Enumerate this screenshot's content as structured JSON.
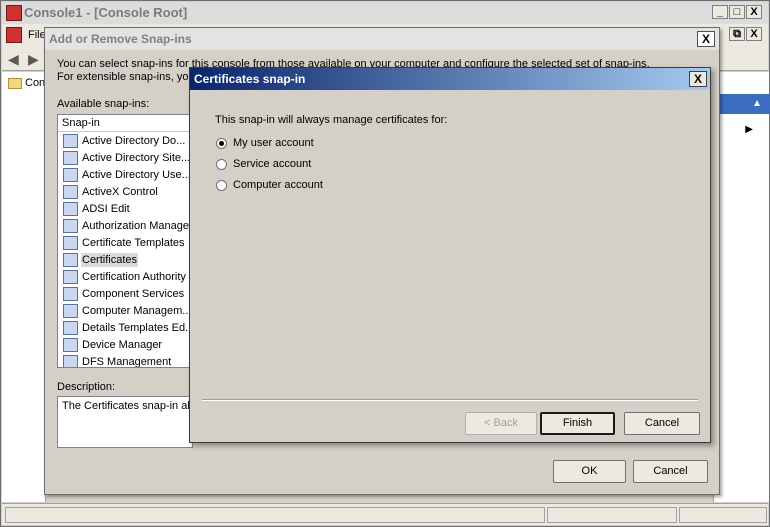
{
  "console": {
    "title": "Console1 - [Console Root]",
    "menu_file": "File",
    "tree_root": "Con",
    "window_buttons": {
      "minimize": "_",
      "maximize": "□",
      "close": "X",
      "restore": "⧉"
    }
  },
  "snapins": {
    "title": "Add or Remove Snap-ins",
    "intro": "You can select snap-ins for this console from those available on your computer and configure the selected set of snap-ins. For extensible snap-ins, you ca",
    "available_label": "Available snap-ins:",
    "list_header": "Snap-in",
    "items": [
      "Active Directory Do...",
      "Active Directory Site...",
      "Active Directory Use...",
      "ActiveX Control",
      "ADSI Edit",
      "Authorization Manager",
      "Certificate Templates",
      "Certificates",
      "Certification Authority",
      "Component Services",
      "Computer Managem...",
      "Details Templates Ed...",
      "Device Manager",
      "DFS Management"
    ],
    "selected_item": "Certificates",
    "description_label": "Description:",
    "description_text": "The Certificates snap-in all",
    "ok_label": "OK",
    "cancel_label": "Cancel",
    "close_glyph": "X"
  },
  "cert_dialog": {
    "title": "Certificates snap-in",
    "prompt": "This snap-in will always manage certificates for:",
    "options": [
      {
        "label": "My user account",
        "selected": true
      },
      {
        "label": "Service account",
        "selected": false
      },
      {
        "label": "Computer account",
        "selected": false
      }
    ],
    "back_label": "< Back",
    "finish_label": "Finish",
    "cancel_label": "Cancel",
    "close_glyph": "X"
  },
  "colors": {
    "title_gradient_start": "#0a246a",
    "title_gradient_end": "#a6caf0",
    "actions_header": "#3c6ebf",
    "dialog_face": "#d4d0c8"
  }
}
